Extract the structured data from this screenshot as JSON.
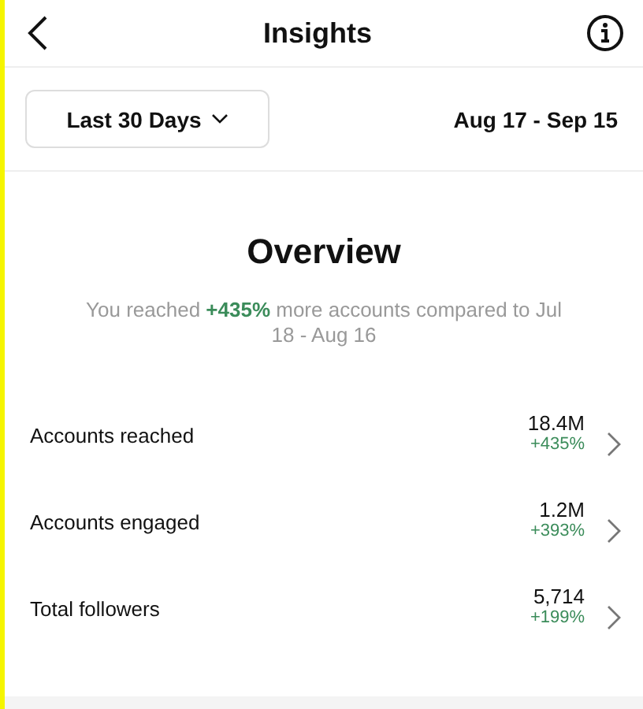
{
  "header": {
    "title": "Insights"
  },
  "date_range": {
    "period": "Last 30 Days",
    "dates": "Aug 17 - Sep 15"
  },
  "overview": {
    "title": "Overview",
    "summary": "You reached **+435%** more accounts compared to Jul 18 - Aug 16"
  },
  "metrics": [
    {
      "label": "Accounts reached",
      "value": "18.4M",
      "change": "+435%"
    },
    {
      "label": "Accounts engaged",
      "value": "1.2M",
      "change": "+393%"
    },
    {
      "label": "Total followers",
      "value": "5,714",
      "change": "+199%"
    }
  ]
}
